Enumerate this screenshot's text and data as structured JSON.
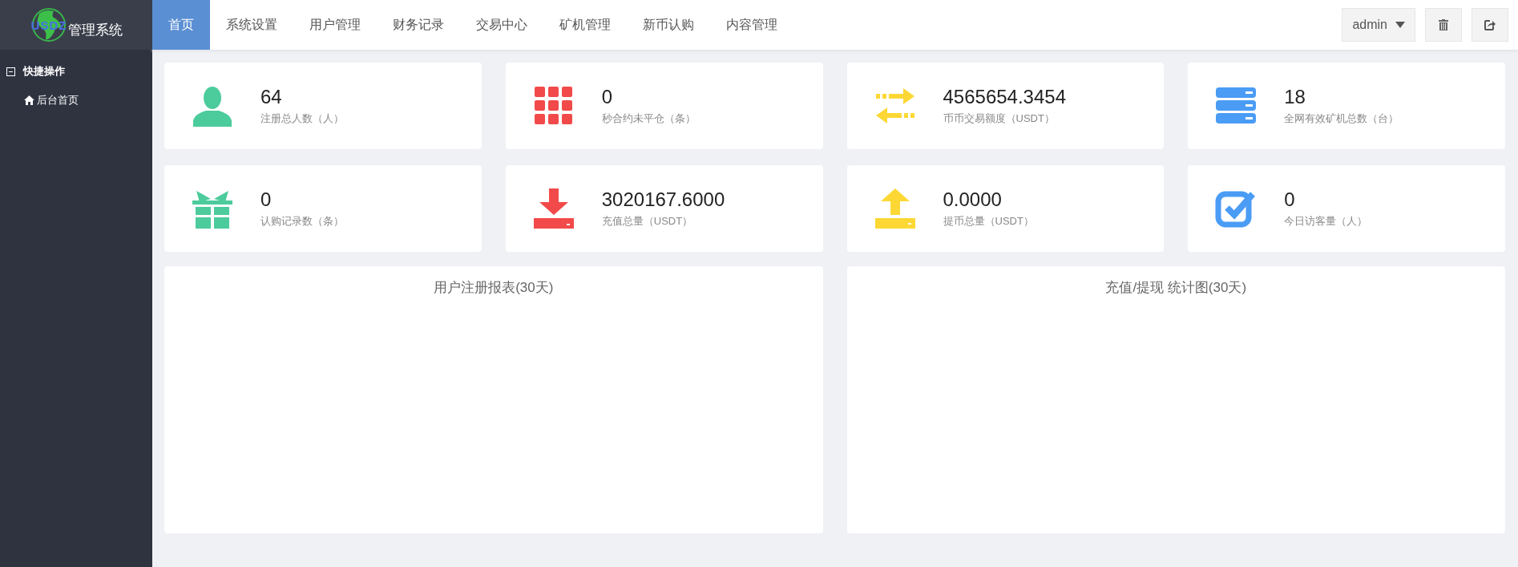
{
  "logo": {
    "mark": "USDZ",
    "title": "管理系统"
  },
  "nav": {
    "tabs": [
      {
        "label": "首页",
        "selected": true
      },
      {
        "label": "系统设置",
        "selected": false
      },
      {
        "label": "用户管理",
        "selected": false
      },
      {
        "label": "财务记录",
        "selected": false
      },
      {
        "label": "交易中心",
        "selected": false
      },
      {
        "label": "矿机管理",
        "selected": false
      },
      {
        "label": "新币认购",
        "selected": false
      },
      {
        "label": "内容管理",
        "selected": false
      }
    ],
    "user": "admin"
  },
  "sidebar": {
    "groups": [
      {
        "label": "快捷操作",
        "expanded": true,
        "children": [
          {
            "label": "后台首页"
          }
        ]
      }
    ]
  },
  "stats": [
    {
      "kind": "user",
      "color": "#4ccb9c",
      "value": "64",
      "label": "注册总人数（人）"
    },
    {
      "kind": "grid",
      "color": "#f24a4a",
      "value": "0",
      "label": "秒合约未平仓（条）"
    },
    {
      "kind": "exchange",
      "color": "#fdd835",
      "value": "4565654.3454",
      "label": "币币交易额度（USDT）"
    },
    {
      "kind": "server",
      "color": "#4a9cf5",
      "value": "18",
      "label": "全网有效矿机总数（台）"
    },
    {
      "kind": "gift",
      "color": "#4ccb9c",
      "value": "0",
      "label": "认购记录数（条）"
    },
    {
      "kind": "download",
      "color": "#f24a4a",
      "value": "3020167.6000",
      "label": "充值总量（USDT）"
    },
    {
      "kind": "upload",
      "color": "#fdd835",
      "value": "0.0000",
      "label": "提币总量（USDT）"
    },
    {
      "kind": "check",
      "color": "#4a9cf5",
      "value": "0",
      "label": "今日访客量（人）"
    }
  ],
  "charts": [
    {
      "title": "用户注册报表(30天)"
    },
    {
      "title": "充值/提现 统计图(30天)"
    }
  ]
}
